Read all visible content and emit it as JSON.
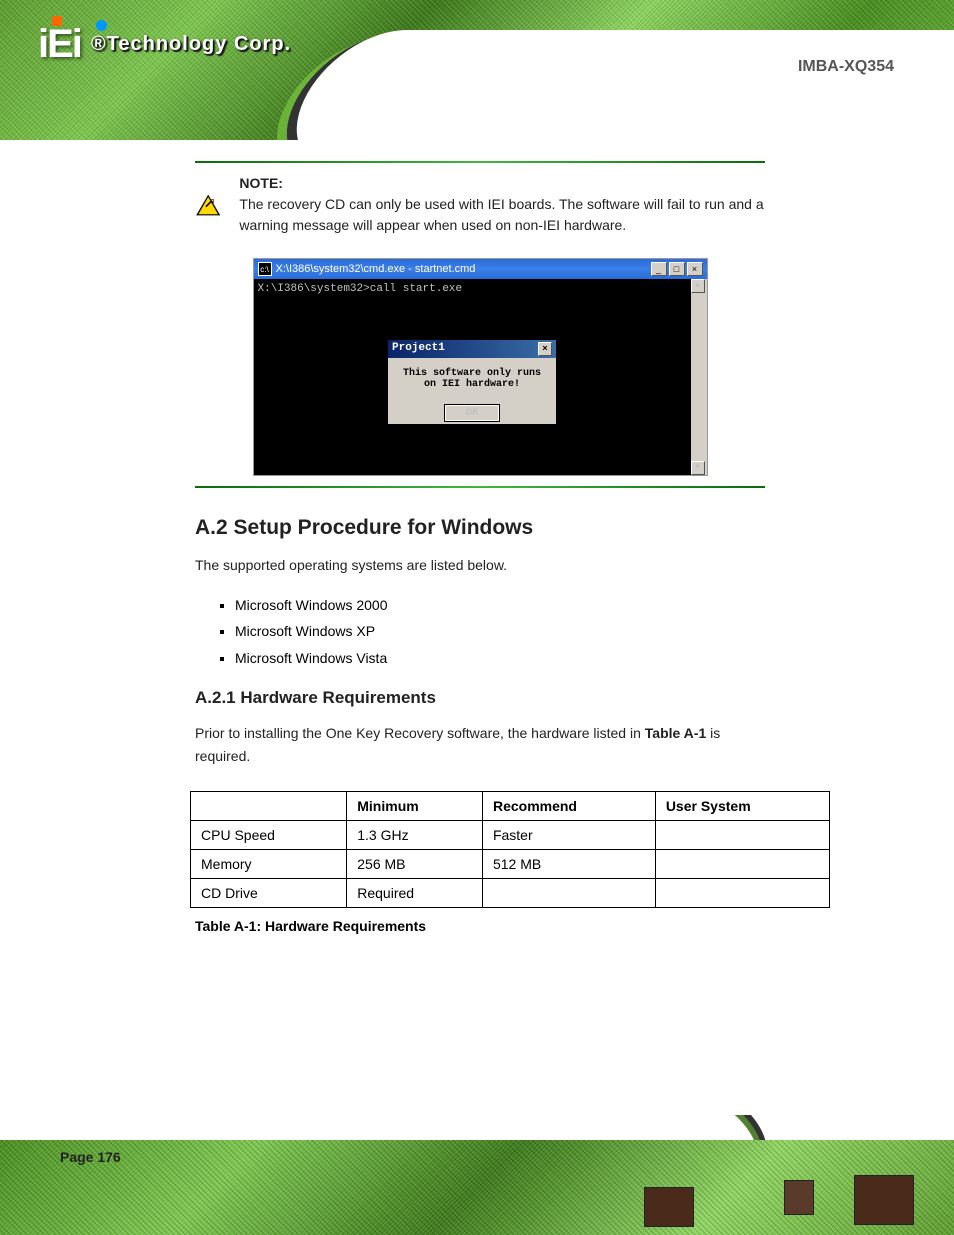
{
  "header": {
    "logo_text": "iEi",
    "logo_sub": "®Technology Corp.",
    "product": "IMBA-XQ354"
  },
  "note": {
    "label": "NOTE:",
    "text": "The recovery CD can only be used with IEI boards. The software will fail to run and a warning message will appear when used on non-IEI hardware."
  },
  "screenshot": {
    "cmd_title": "X:\\I386\\system32\\cmd.exe - startnet.cmd",
    "cmd_line": "X:\\I386\\system32>call start.exe",
    "dialog_title": "Project1",
    "dialog_msg": "This software only runs on IEI hardware!",
    "dialog_ok": "OK"
  },
  "section": {
    "heading": "A.2 Setup Procedure for Windows",
    "subheading": "A.2.1 Hardware Requirements",
    "para1": "The supported operating systems are listed below.",
    "bullets": [
      "Microsoft Windows 2000",
      "Microsoft Windows XP",
      "Microsoft Windows Vista"
    ],
    "para2": "Prior to installing the One Key Recovery software, the hardware listed in",
    "para2_ref": "Table A-1",
    "para2_cont": " is required."
  },
  "table": {
    "headers": [
      "",
      "Minimum",
      "Recommend",
      "User System"
    ],
    "rows": [
      [
        "CPU Speed",
        "1.3 GHz",
        "Faster",
        ""
      ],
      [
        "Memory",
        "256 MB",
        "512 MB",
        ""
      ],
      [
        "CD Drive",
        "Required",
        "",
        ""
      ]
    ],
    "caption": "Table A-1: Hardware Requirements"
  },
  "footer": {
    "page": "Page 176"
  }
}
